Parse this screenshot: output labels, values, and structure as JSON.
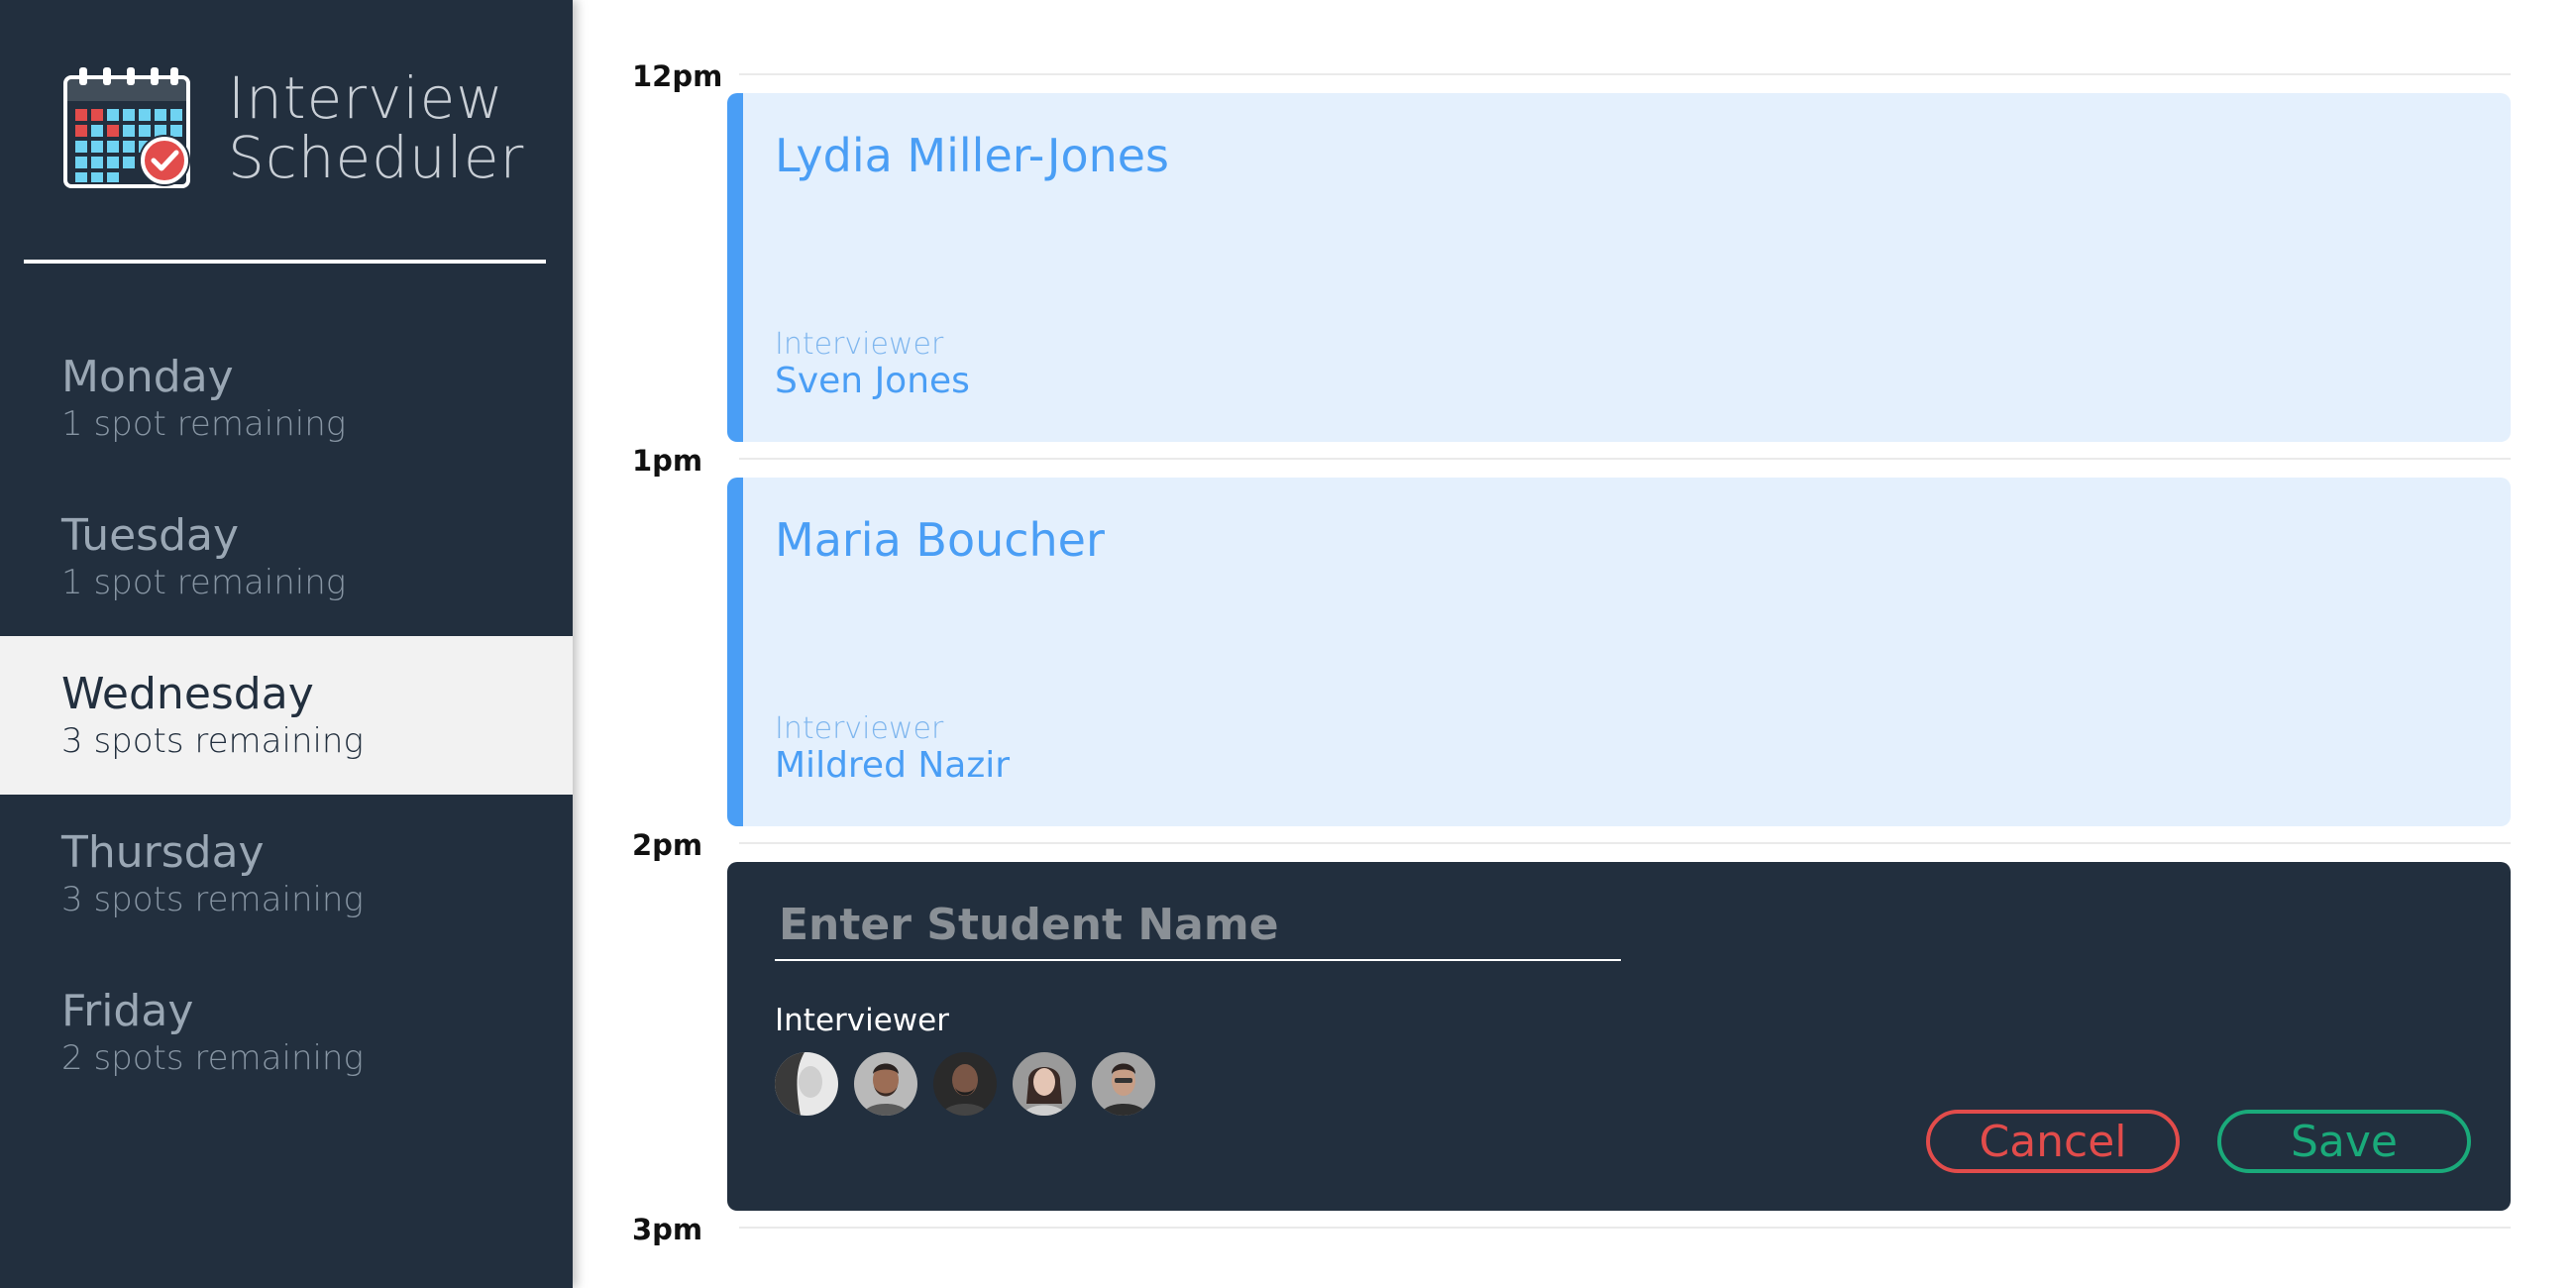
{
  "app": {
    "title_line1": "Interview",
    "title_line2": "Scheduler",
    "logo_icon": "calendar-check-icon"
  },
  "sidebar": {
    "days": [
      {
        "name": "Monday",
        "spots": "1 spot remaining"
      },
      {
        "name": "Tuesday",
        "spots": "1 spot remaining"
      },
      {
        "name": "Wednesday",
        "spots": "3 spots remaining"
      },
      {
        "name": "Thursday",
        "spots": "3 spots remaining"
      },
      {
        "name": "Friday",
        "spots": "2 spots remaining"
      }
    ]
  },
  "schedule": {
    "times": [
      "12pm",
      "1pm",
      "2pm",
      "3pm"
    ],
    "appointments": [
      {
        "student": "Lydia Miller-Jones",
        "interviewer_label": "Interviewer",
        "interviewer": "Sven Jones"
      },
      {
        "student": "Maria Boucher",
        "interviewer_label": "Interviewer",
        "interviewer": "Mildred Nazir"
      }
    ],
    "form": {
      "placeholder": "Enter Student Name",
      "value": "",
      "interviewer_label": "Interviewer",
      "cancel_label": "Cancel",
      "save_label": "Save"
    }
  },
  "colors": {
    "sidebar_bg": "#222f3e",
    "appointment_bg": "#e4f0fd",
    "appointment_accent": "#4a9ef5",
    "cancel": "#e24c4b",
    "save": "#1aaa7a"
  }
}
